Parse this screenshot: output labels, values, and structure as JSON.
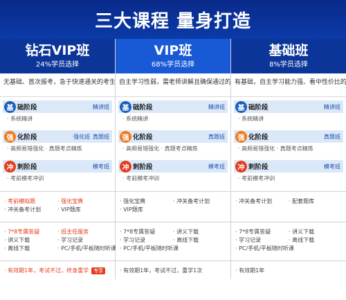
{
  "banner": {
    "title": "三大课程 量身打造"
  },
  "columns": [
    {
      "name": "钻石VIP班",
      "pct": "24%学员选择",
      "desc": "无基础、首次报考，急于快速通关的考生",
      "stages": [
        {
          "icon": "基",
          "title": "础阶段",
          "tags": [
            "精讲班"
          ],
          "item": "· 系统精讲"
        },
        {
          "icon": "强",
          "title": "化阶段",
          "tags": [
            "强化班",
            "真题班"
          ],
          "item": "· 高频易错强化     · 真题考点精炼"
        },
        {
          "icon": "冲",
          "title": "刺阶段",
          "tags": [
            "模考班"
          ],
          "item": "· 考前模考冲训"
        }
      ],
      "features": [
        {
          "text": "· 考前模拟题",
          "red": true
        },
        {
          "text": "· 强化宝典",
          "red": true
        },
        {
          "text": "· 冲关备考计划",
          "red": false
        },
        {
          "text": "· VIP题库",
          "red": false
        }
      ],
      "services": [
        {
          "text": "· 7*8专属答疑",
          "red": true
        },
        {
          "text": "· 班主任服务",
          "red": true
        },
        {
          "text": "· 讲义下载",
          "red": false
        },
        {
          "text": "· 学习记录",
          "red": false
        },
        {
          "text": "· 离线下载",
          "red": false
        },
        {
          "text": "· PC/手机/平板随时听课",
          "red": false
        }
      ],
      "note": {
        "text": "· 有效期1年，考试不过，终身重学",
        "badge": "专享",
        "red": true
      }
    },
    {
      "name": "VIP班",
      "pct": "68%学员选择",
      "desc": "自主学习性弱，需老师讲解且确保通过的学员",
      "stages": [
        {
          "icon": "基",
          "title": "础阶段",
          "tags": [
            "精讲班"
          ],
          "item": "· 系统精讲"
        },
        {
          "icon": "强",
          "title": "化阶段",
          "tags": [
            "真题班"
          ],
          "item": "· 高频易错强化     · 真题考点精炼"
        },
        {
          "icon": "冲",
          "title": "刺阶段",
          "tags": [
            "模考班"
          ],
          "item": "· 考前模考冲训"
        }
      ],
      "features": [
        {
          "text": "· 强化宝典",
          "red": false
        },
        {
          "text": "· 冲关备考计划",
          "red": false
        },
        {
          "text": "· VIP题库",
          "red": false
        }
      ],
      "services": [
        {
          "text": "· 7*8专属答疑",
          "red": false
        },
        {
          "text": "· 讲义下载",
          "red": false
        },
        {
          "text": "· 学习记录",
          "red": false
        },
        {
          "text": "· 离线下载",
          "red": false
        },
        {
          "text": "· PC/手机/平板随时听课",
          "red": false
        }
      ],
      "note": {
        "text": "· 有效期1年，考试不过，重学1次",
        "badge": "",
        "red": false
      }
    },
    {
      "name": "基础班",
      "pct": "8%学员选择",
      "desc": "有基础，自主学习能力强、看中性价比的考生",
      "stages": [
        {
          "icon": "基",
          "title": "础阶段",
          "tags": [
            "精讲班"
          ],
          "item": "· 系统精讲"
        },
        {
          "icon": "强",
          "title": "化阶段",
          "tags": [
            "真题班"
          ],
          "item": "· 高频易错强化     · 真题考点精炼"
        },
        {
          "icon": "冲",
          "title": "刺阶段",
          "tags": [
            "模考班"
          ],
          "item": "· 考前模考冲训"
        }
      ],
      "features": [
        {
          "text": "· 冲关备考计划",
          "red": false
        },
        {
          "text": "· 配套题库",
          "red": false
        }
      ],
      "services": [
        {
          "text": "· 7*8专属答疑",
          "red": false
        },
        {
          "text": "· 讲义下载",
          "red": false
        },
        {
          "text": "· 学习记录",
          "red": false
        },
        {
          "text": "· 离线下载",
          "red": false
        },
        {
          "text": "· PC/手机/平板随时听课",
          "red": false
        }
      ],
      "note": {
        "text": "· 有效期1年",
        "badge": "",
        "red": false
      }
    }
  ]
}
